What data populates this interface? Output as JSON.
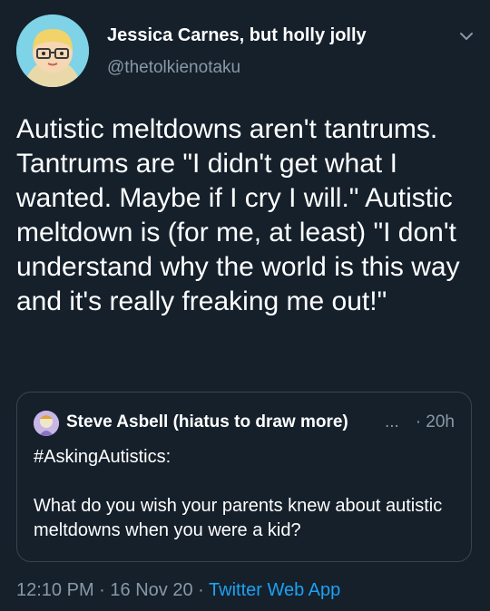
{
  "author": {
    "name": "Jessica Carnes, but holly jolly",
    "handle": "@thetolkienotaku",
    "avatar_icon": "cartoon-avatar-with-glasses"
  },
  "tweet": {
    "text": "Autistic meltdowns aren't tantrums. Tantrums are \"I didn't get what I wanted. Maybe if I cry I will.\" Autistic meltdown is (for me, at least) \"I don't understand why the world is this way and it's really freaking me out!\""
  },
  "quoted_tweet": {
    "author_name": "Steve Asbell (hiatus to draw more)",
    "ellipsis": "...",
    "time": "· 20h",
    "text": "#AskingAutistics:\n\nWhat do you wish your parents knew about autistic meltdowns when you were a kid?"
  },
  "footer": {
    "time": "12:10 PM",
    "sep1": "·",
    "date": "16 Nov 20",
    "sep2": "·",
    "source": "Twitter Web App"
  },
  "colors": {
    "background": "#15202b",
    "secondary_text": "#8899a6",
    "link": "#1da1f2",
    "border": "#38444d"
  }
}
